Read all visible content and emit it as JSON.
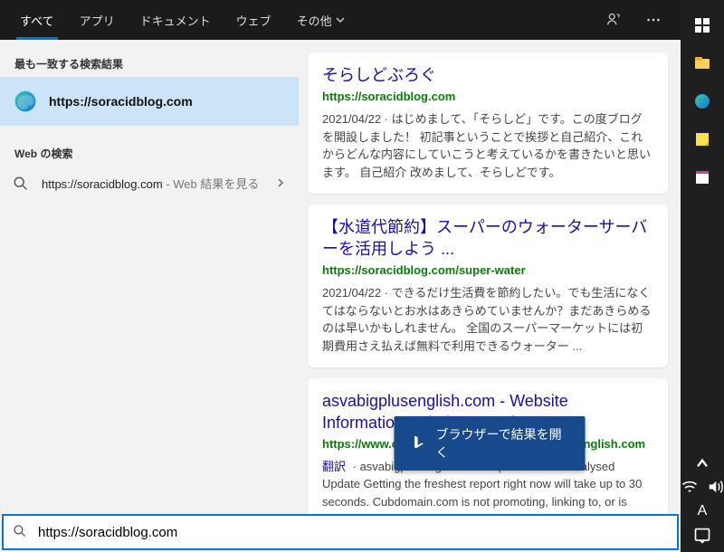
{
  "tabs": {
    "all": "すべて",
    "apps": "アプリ",
    "documents": "ドキュメント",
    "web": "ウェブ",
    "more": "その他"
  },
  "left": {
    "best_match_header": "最も一致する検索結果",
    "best_match_text": "https://soracidblog.com",
    "web_header": "Web の検索",
    "web_item_text": "https://soracidblog.com",
    "web_item_sub": " - Web 結果を見る"
  },
  "results": [
    {
      "title": "そらしどぶろぐ",
      "url": "https://soracidblog.com",
      "snippet": "2021/04/22 · はじめまして、「そらしど」です。この度ブログを開設しました！ 初記事ということで挨拶と自己紹介、これからどんな内容にしていこうと考えているかを書きたいと思います。 自己紹介 改めまして、そらしどです。"
    },
    {
      "title": "【水道代節約】スーパーのウォーターサーバーを活用しよう ...",
      "url": "https://soracidblog.com/super-water",
      "snippet": "2021/04/22 · できるだけ生活費を節約したい。でも生活になくてはならないとお水はあきらめていませんか？まだあきらめるのは早いかもしれません。 全国のスーパーマーケットには初期費用さえ払えば無料で利用できるウォーター ..."
    },
    {
      "title": "asvabigplusenglish.com - Website Information, Whois Record ...",
      "url": "https://www.cubdomain.com/site/asvabigplusenglish.com",
      "trans": "翻訳",
      "snippet": " · asvabigplusenglish.com report was last analysed Update Getting the freshest report right now will take up to 30 seconds. Cubdomain.com is not promoting, linking to, or is affiliated with asvabigplusenglish.com in any way. We ..."
    }
  ],
  "open_browser": "ブラウザーで結果を開く",
  "search_value": "https://soracidblog.com",
  "ime": "A"
}
